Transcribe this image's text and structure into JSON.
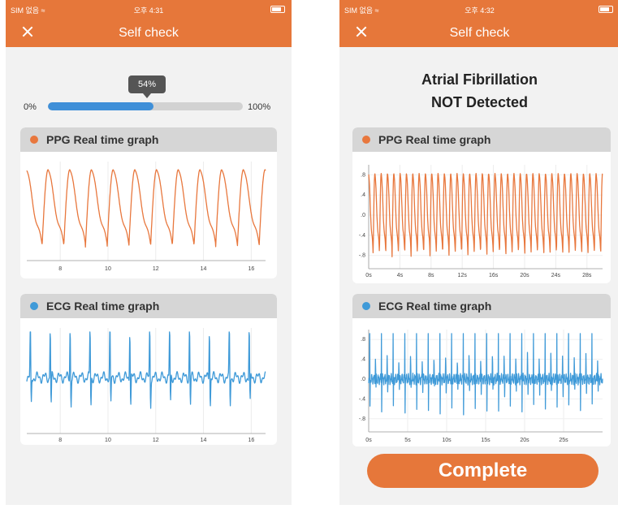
{
  "screens": [
    {
      "status": {
        "carrier": "SIM 없음",
        "time": "오후 4:31"
      },
      "header": {
        "title": "Self check"
      },
      "progress": {
        "tooltip": "54%",
        "value_percent": 54,
        "min_label": "0%",
        "max_label": "100%"
      },
      "ppg": {
        "title": "PPG Real time graph"
      },
      "ecg": {
        "title": "ECG Real time graph"
      }
    },
    {
      "status": {
        "carrier": "SIM 없음",
        "time": "오후 4:32"
      },
      "header": {
        "title": "Self check"
      },
      "result": {
        "line1": "Atrial Fibrillation",
        "line2": "NOT Detected"
      },
      "ppg": {
        "title": "PPG Real time graph"
      },
      "ecg": {
        "title": "ECG Real time graph"
      },
      "complete_button": "Complete"
    }
  ],
  "colors": {
    "accent": "#e6773a",
    "ppg": "#e8773d",
    "ecg": "#3f9ad8",
    "progress": "#3f8fd8"
  },
  "icons": {
    "close": "close-icon",
    "wifi": "wifi-icon",
    "battery": "battery-icon"
  },
  "chart_data": [
    {
      "type": "line",
      "series": [
        {
          "name": "PPG Real time graph"
        }
      ],
      "xlim": [
        6.6,
        16.6
      ],
      "x_ticks": [
        "8",
        "10",
        "12",
        "14",
        "16"
      ],
      "cycles": 11,
      "grid": true
    },
    {
      "type": "line",
      "series": [
        {
          "name": "ECG Real time graph"
        }
      ],
      "xlim": [
        6.6,
        16.6
      ],
      "x_ticks": [
        "8",
        "10",
        "12",
        "14",
        "16"
      ],
      "cycles": 12,
      "grid": true
    },
    {
      "type": "line",
      "series": [
        {
          "name": "PPG Real time graph"
        }
      ],
      "xlim": [
        0,
        30
      ],
      "ylim": [
        -1,
        1
      ],
      "x_ticks": [
        "0s",
        "4s",
        "8s",
        "12s",
        "16s",
        "20s",
        "24s",
        "28s"
      ],
      "y_ticks": [
        ".8",
        ".4",
        ".0",
        "-.4",
        "-.8"
      ],
      "cycles": 37,
      "grid": true
    },
    {
      "type": "line",
      "series": [
        {
          "name": "ECG Real time graph"
        }
      ],
      "xlim": [
        0,
        30
      ],
      "ylim": [
        -1,
        1
      ],
      "x_ticks": [
        "0s",
        "5s",
        "10s",
        "15s",
        "20s",
        "25s"
      ],
      "y_ticks": [
        ".8",
        ".4",
        ".0",
        "-.4",
        "-.8"
      ],
      "cycles": 40,
      "grid": true
    }
  ]
}
